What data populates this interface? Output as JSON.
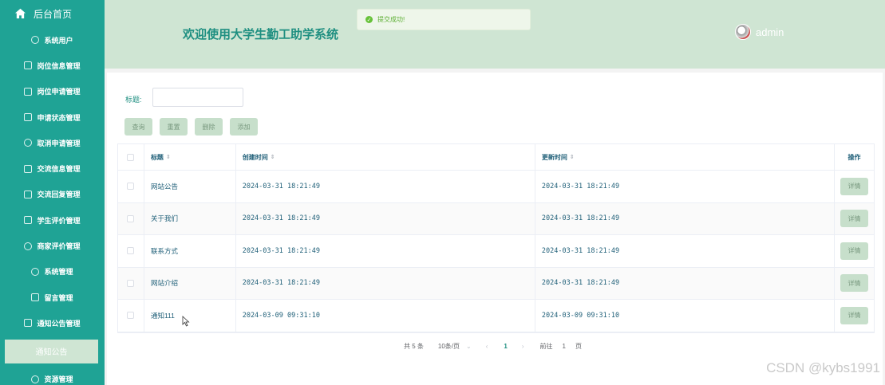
{
  "sidebar": {
    "home_label": "后台首页",
    "items": [
      {
        "label": "系统用户",
        "icon": "globe-icon"
      },
      {
        "label": "岗位信息管理",
        "icon": "edit-icon"
      },
      {
        "label": "岗位申请管理",
        "icon": "check-square-icon"
      },
      {
        "label": "申请状态管理",
        "icon": "edit-icon"
      },
      {
        "label": "取消申请管理",
        "icon": "globe-icon"
      },
      {
        "label": "交流信息管理",
        "icon": "check-square-icon"
      },
      {
        "label": "交流回复管理",
        "icon": "doc-icon"
      },
      {
        "label": "学生评价管理",
        "icon": "edit-icon"
      },
      {
        "label": "商家评价管理",
        "icon": "globe-icon"
      },
      {
        "label": "系统管理",
        "icon": "globe-icon"
      },
      {
        "label": "留言管理",
        "icon": "doc-icon"
      },
      {
        "label": "通知公告管理",
        "icon": "check-square-icon"
      }
    ],
    "active_sub": "通知公告",
    "next_item": "资源管理"
  },
  "header": {
    "title": "欢迎使用大学生勤工助学系统",
    "username": "admin"
  },
  "toast": {
    "message": "提交成功!"
  },
  "search": {
    "label": "标题:",
    "value": ""
  },
  "buttons": {
    "query": "查询",
    "reset": "重置",
    "delete": "删除",
    "add": "添加"
  },
  "table": {
    "headers": {
      "title": "标题",
      "created": "创建时间",
      "updated": "更新时间",
      "action": "操作"
    },
    "rows": [
      {
        "title": "网站公告",
        "created": "2024-03-31 18:21:49",
        "updated": "2024-03-31 18:21:49",
        "action": "详情"
      },
      {
        "title": "关于我们",
        "created": "2024-03-31 18:21:49",
        "updated": "2024-03-31 18:21:49",
        "action": "详情"
      },
      {
        "title": "联系方式",
        "created": "2024-03-31 18:21:49",
        "updated": "2024-03-31 18:21:49",
        "action": "详情"
      },
      {
        "title": "网站介绍",
        "created": "2024-03-31 18:21:49",
        "updated": "2024-03-31 18:21:49",
        "action": "详情"
      },
      {
        "title": "通知111",
        "created": "2024-03-09 09:31:10",
        "updated": "2024-03-09 09:31:10",
        "action": "详情"
      }
    ]
  },
  "pagination": {
    "total": "共 5 条",
    "page_size": "10条/页",
    "current_page": "1",
    "goto_label": "前往",
    "goto_value": "1",
    "page_suffix": "页"
  },
  "watermark": "CSDN @kybs1991",
  "colors": {
    "sidebar": "#1fa395",
    "header": "#cfe5d3",
    "accent": "#1f8f81",
    "button": "#c7dfcb",
    "success": "#67c23a"
  }
}
